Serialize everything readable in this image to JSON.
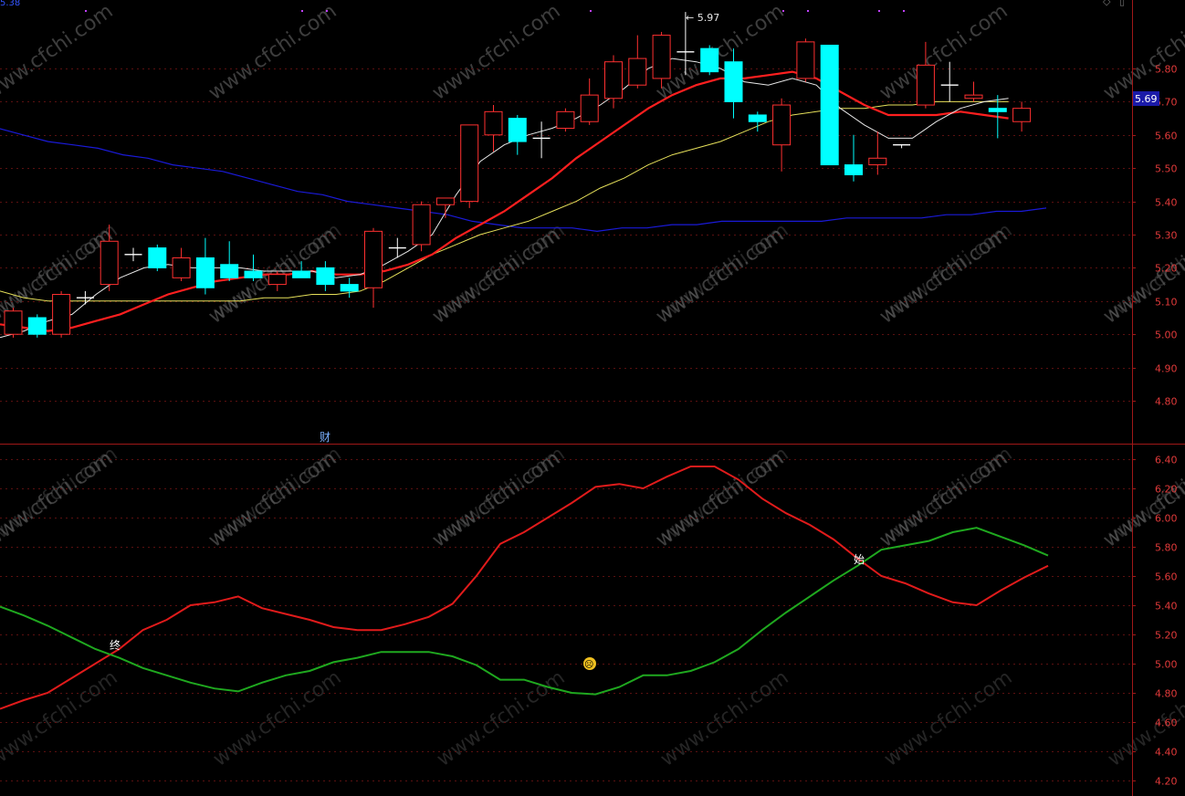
{
  "top_left_label": "5.38",
  "top_right_icons": [
    "diamond-icon",
    "scroll-icon"
  ],
  "price_tag": "5.69",
  "watermark": "www.cfchi.com",
  "cai_marker": "财",
  "signals": {
    "end": "终",
    "start": "始",
    "emoji": "☹"
  },
  "chart_data": [
    {
      "type": "candlestick",
      "title": "",
      "ylim": [
        4.7,
        6.0
      ],
      "yticks": [
        "5.80",
        "5.70",
        "5.60",
        "5.50",
        "5.40",
        "5.30",
        "5.20",
        "5.10",
        "5.00",
        "4.90",
        "4.80"
      ],
      "peak_label": "5.97",
      "ohlc": [
        [
          5.0,
          5.08,
          4.99,
          5.07
        ],
        [
          5.05,
          5.06,
          4.99,
          5.0
        ],
        [
          5.0,
          5.13,
          4.99,
          5.12
        ],
        [
          5.11,
          5.13,
          5.09,
          5.11
        ],
        [
          5.15,
          5.33,
          5.13,
          5.28
        ],
        [
          5.24,
          5.26,
          5.22,
          5.24
        ],
        [
          5.26,
          5.27,
          5.19,
          5.2
        ],
        [
          5.17,
          5.26,
          5.16,
          5.23
        ],
        [
          5.23,
          5.29,
          5.12,
          5.14
        ],
        [
          5.21,
          5.28,
          5.16,
          5.17
        ],
        [
          5.19,
          5.24,
          5.16,
          5.17
        ],
        [
          5.15,
          5.19,
          5.13,
          5.18
        ],
        [
          5.19,
          5.22,
          5.17,
          5.17
        ],
        [
          5.2,
          5.22,
          5.13,
          5.15
        ],
        [
          5.15,
          5.17,
          5.11,
          5.13
        ],
        [
          5.14,
          5.32,
          5.08,
          5.31
        ],
        [
          5.26,
          5.29,
          5.23,
          5.26
        ],
        [
          5.27,
          5.4,
          5.25,
          5.39
        ],
        [
          5.39,
          5.41,
          5.35,
          5.41
        ],
        [
          5.4,
          5.63,
          5.38,
          5.63
        ],
        [
          5.6,
          5.69,
          5.55,
          5.67
        ],
        [
          5.65,
          5.66,
          5.54,
          5.58
        ],
        [
          5.59,
          5.64,
          5.53,
          5.59
        ],
        [
          5.62,
          5.68,
          5.61,
          5.67
        ],
        [
          5.64,
          5.77,
          5.63,
          5.72
        ],
        [
          5.71,
          5.84,
          5.68,
          5.82
        ],
        [
          5.75,
          5.9,
          5.74,
          5.83
        ],
        [
          5.77,
          5.91,
          5.74,
          5.9
        ],
        [
          5.85,
          5.97,
          5.78,
          5.85
        ],
        [
          5.86,
          5.87,
          5.78,
          5.79
        ],
        [
          5.82,
          5.86,
          5.65,
          5.7
        ],
        [
          5.66,
          5.67,
          5.61,
          5.64
        ],
        [
          5.57,
          5.71,
          5.49,
          5.69
        ],
        [
          5.77,
          5.89,
          5.76,
          5.88
        ],
        [
          5.87,
          5.87,
          5.51,
          5.51
        ],
        [
          5.51,
          5.6,
          5.46,
          5.48
        ],
        [
          5.51,
          5.61,
          5.48,
          5.53
        ],
        [
          5.57,
          5.57,
          5.56,
          5.57
        ],
        [
          5.69,
          5.88,
          5.68,
          5.81
        ],
        [
          5.75,
          5.82,
          5.7,
          5.75
        ],
        [
          5.71,
          5.76,
          5.7,
          5.72
        ],
        [
          5.68,
          5.72,
          5.59,
          5.67
        ],
        [
          5.64,
          5.7,
          5.61,
          5.68
        ]
      ],
      "ma_short": [
        4.99,
        5.01,
        5.04,
        5.06,
        5.12,
        5.17,
        5.2,
        5.21,
        5.2,
        5.2,
        5.2,
        5.19,
        5.19,
        5.19,
        5.17,
        5.18,
        5.21,
        5.25,
        5.3,
        5.42,
        5.52,
        5.57,
        5.6,
        5.62,
        5.65,
        5.69,
        5.74,
        5.8,
        5.83,
        5.82,
        5.8,
        5.76,
        5.75,
        5.77,
        5.75,
        5.68,
        5.63,
        5.59,
        5.59,
        5.64,
        5.68,
        5.7,
        5.71
      ],
      "ma_mid": [
        5.03,
        5.02,
        5.01,
        5.02,
        5.04,
        5.06,
        5.09,
        5.12,
        5.14,
        5.16,
        5.17,
        5.18,
        5.18,
        5.19,
        5.18,
        5.18,
        5.19,
        5.21,
        5.24,
        5.29,
        5.33,
        5.37,
        5.42,
        5.47,
        5.53,
        5.58,
        5.63,
        5.68,
        5.72,
        5.75,
        5.77,
        5.77,
        5.78,
        5.79,
        5.77,
        5.73,
        5.69,
        5.66,
        5.66,
        5.66,
        5.67,
        5.66,
        5.65
      ],
      "ma_long": [
        5.13,
        5.11,
        5.1,
        5.1,
        5.1,
        5.1,
        5.1,
        5.1,
        5.1,
        5.1,
        5.1,
        5.11,
        5.11,
        5.12,
        5.12,
        5.13,
        5.16,
        5.2,
        5.24,
        5.27,
        5.3,
        5.32,
        5.34,
        5.37,
        5.4,
        5.44,
        5.47,
        5.51,
        5.54,
        5.56,
        5.58,
        5.61,
        5.64,
        5.66,
        5.67,
        5.68,
        5.68,
        5.69,
        5.69,
        5.7,
        5.7,
        5.7,
        5.7
      ],
      "ma_xlong": [
        5.62,
        5.6,
        5.58,
        5.57,
        5.56,
        5.54,
        5.53,
        5.51,
        5.5,
        5.49,
        5.47,
        5.45,
        5.43,
        5.42,
        5.4,
        5.39,
        5.38,
        5.37,
        5.36,
        5.34,
        5.33,
        5.32,
        5.32,
        5.32,
        5.31,
        5.32,
        5.32,
        5.33,
        5.33,
        5.34,
        5.34,
        5.34,
        5.34,
        5.34,
        5.35,
        5.35,
        5.35,
        5.35,
        5.36,
        5.36,
        5.37,
        5.37,
        5.38
      ]
    },
    {
      "type": "line",
      "title": "",
      "ylim": [
        4.15,
        6.5
      ],
      "yticks": [
        "6.40",
        "6.20",
        "6.00",
        "5.80",
        "5.60",
        "5.40",
        "5.20",
        "5.00",
        "4.80",
        "4.60",
        "4.40",
        "4.20"
      ],
      "series": [
        {
          "color": "#e01b1b",
          "values": [
            4.69,
            4.75,
            4.8,
            4.9,
            5.0,
            5.1,
            5.23,
            5.3,
            5.4,
            5.42,
            5.46,
            5.38,
            5.34,
            5.3,
            5.25,
            5.23,
            5.23,
            5.27,
            5.32,
            5.41,
            5.6,
            5.82,
            5.9,
            6.0,
            6.1,
            6.21,
            6.23,
            6.2,
            6.28,
            6.35,
            6.35,
            6.26,
            6.13,
            6.03,
            5.95,
            5.85,
            5.72,
            5.6,
            5.55,
            5.48,
            5.42,
            5.4,
            5.5,
            5.59,
            5.67
          ]
        },
        {
          "color": "#1fa81f",
          "values": [
            5.39,
            5.33,
            5.26,
            5.18,
            5.1,
            5.04,
            4.97,
            4.92,
            4.87,
            4.83,
            4.81,
            4.87,
            4.92,
            4.95,
            5.01,
            5.04,
            5.08,
            5.08,
            5.08,
            5.05,
            4.99,
            4.89,
            4.89,
            4.84,
            4.8,
            4.79,
            4.84,
            4.92,
            4.92,
            4.95,
            5.01,
            5.1,
            5.23,
            5.35,
            5.46,
            5.57,
            5.67,
            5.78,
            5.81,
            5.84,
            5.9,
            5.93,
            5.87,
            5.81,
            5.74
          ]
        }
      ]
    }
  ]
}
